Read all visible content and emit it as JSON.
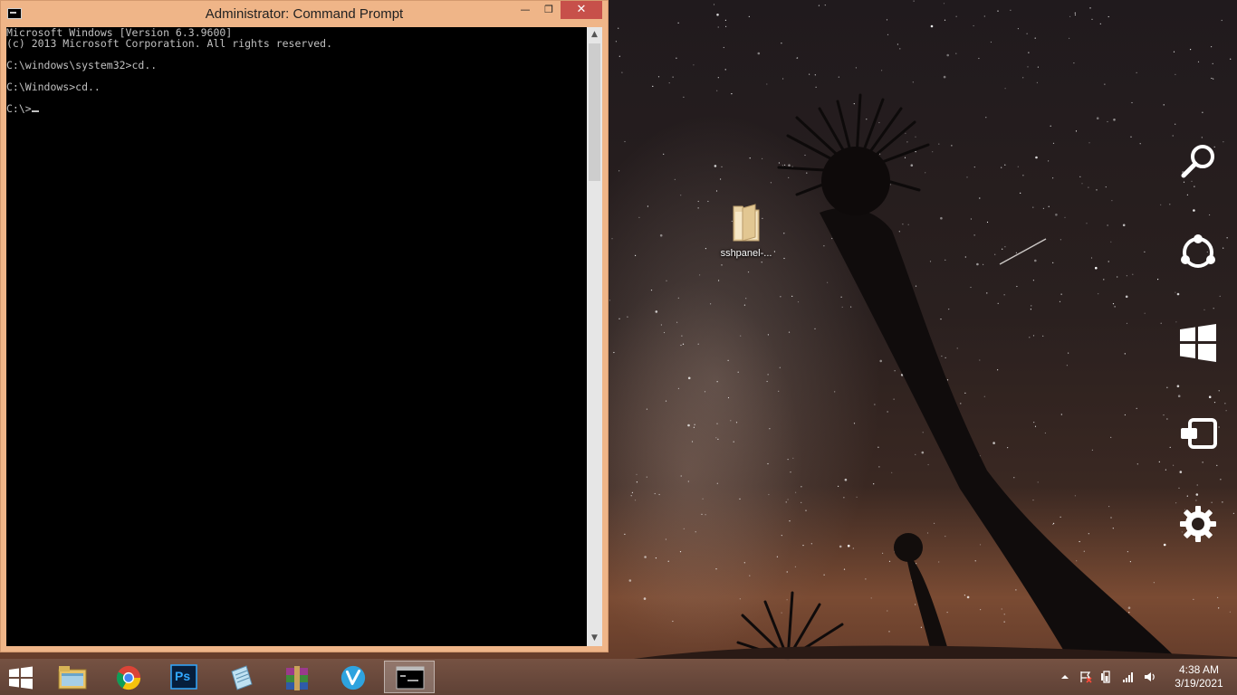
{
  "window": {
    "title": "Administrator: Command Prompt",
    "buttons": {
      "minimize": "—",
      "maximize": "❐",
      "close": "✕"
    }
  },
  "console": {
    "lines": [
      "Microsoft Windows [Version 6.3.9600]",
      "(c) 2013 Microsoft Corporation. All rights reserved.",
      "",
      "C:\\windows\\system32>cd..",
      "",
      "C:\\Windows>cd..",
      "",
      "C:\\>"
    ]
  },
  "desktop": {
    "icons": [
      {
        "label": "sshpanel-...",
        "icon": "folder-icon"
      }
    ]
  },
  "charms": [
    "search-icon",
    "share-icon",
    "start-icon",
    "devices-icon",
    "settings-icon"
  ],
  "taskbar": {
    "apps": [
      {
        "name": "file-explorer",
        "icon": "file-explorer-icon",
        "active": false
      },
      {
        "name": "chrome",
        "icon": "chrome-icon",
        "active": false
      },
      {
        "name": "photoshop",
        "icon": "photoshop-icon",
        "active": false,
        "text": "Ps"
      },
      {
        "name": "notepad",
        "icon": "notepad-icon",
        "active": false
      },
      {
        "name": "winrar",
        "icon": "winrar-icon",
        "active": false
      },
      {
        "name": "vpn",
        "icon": "vpn-icon",
        "active": false
      },
      {
        "name": "cmd",
        "icon": "cmd-icon",
        "active": true
      }
    ],
    "tray": [
      "show-hidden-icons-icon",
      "action-center-flag-icon",
      "power-icon",
      "network-signal-icon",
      "volume-icon"
    ],
    "time": "4:38 AM",
    "date": "3/19/2021"
  },
  "colors": {
    "window_frame": "#efb588",
    "close_button": "#c7504a",
    "console_bg": "#000000",
    "console_text": "#c0c0c0"
  }
}
